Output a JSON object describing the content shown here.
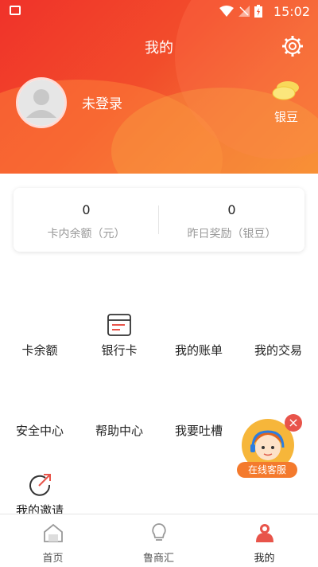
{
  "status_bar": {
    "time": "15:02"
  },
  "header": {
    "title": "我的",
    "login_text": "未登录",
    "beans_label": "银豆"
  },
  "stats": [
    {
      "value": "0",
      "caption": "卡内余额（元）"
    },
    {
      "value": "0",
      "caption": "昨日奖励（银豆）"
    }
  ],
  "grid": {
    "row1": [
      "卡余额",
      "银行卡",
      "我的账单",
      "我的交易"
    ],
    "row2": [
      "安全中心",
      "帮助中心",
      "我要吐槽"
    ],
    "row3": [
      "我的邀请"
    ]
  },
  "floating_service": {
    "label": "在线客服"
  },
  "tabs": [
    {
      "label": "首页",
      "icon": "home-icon"
    },
    {
      "label": "鲁商汇",
      "icon": "lightbulb-icon"
    },
    {
      "label": "我的",
      "icon": "user-icon"
    }
  ],
  "colors": {
    "brand": "#f24d2b",
    "accent_orange": "#f47a2d",
    "close_red": "#e8544a"
  }
}
